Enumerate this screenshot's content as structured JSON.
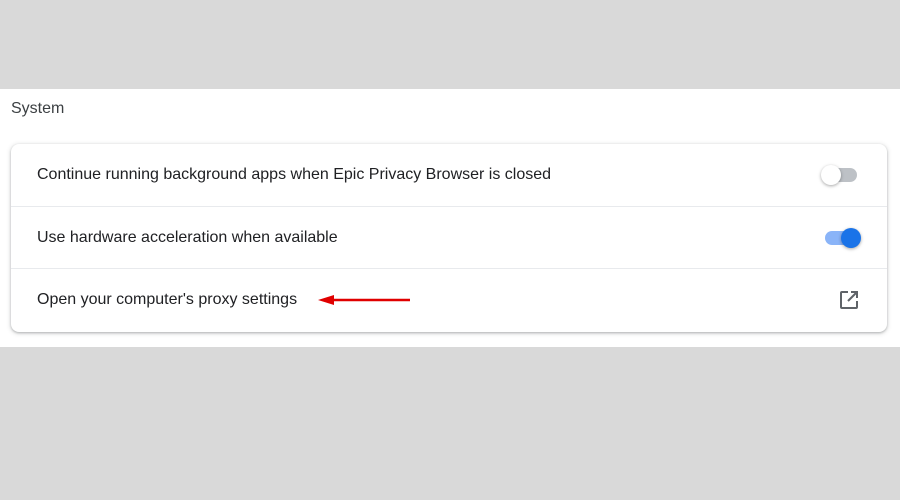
{
  "section": {
    "title": "System"
  },
  "settings": [
    {
      "label": "Continue running background apps when Epic Privacy Browser is closed",
      "control": "toggle",
      "enabled": false
    },
    {
      "label": "Use hardware acceleration when available",
      "control": "toggle",
      "enabled": true
    },
    {
      "label": "Open your computer's proxy settings",
      "control": "external-link",
      "icon": "open-in-new-icon"
    }
  ],
  "colors": {
    "page_background": "#d9d9d9",
    "toggle_on_knob": "#1a73e8",
    "toggle_on_track": "#8ab4f8",
    "toggle_off_track": "#bdc1c6",
    "annotation_arrow": "#e00000",
    "icon": "#5f6368"
  }
}
